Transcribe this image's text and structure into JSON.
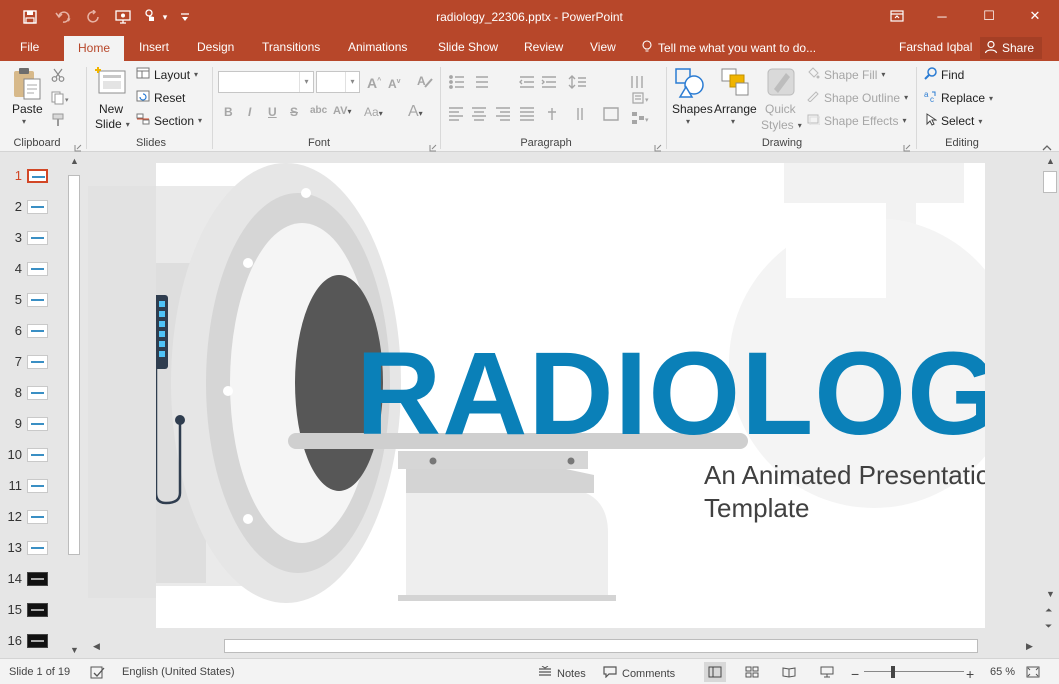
{
  "window": {
    "title": "radiology_22306.pptx - PowerPoint",
    "restore_icon": "ribbon-display-icon",
    "minimize": "─",
    "maximize": "☐",
    "close": "✕"
  },
  "quick_access": [
    "save-icon",
    "undo-icon",
    "redo-icon",
    "present-icon",
    "touch-mode-icon",
    "customize-icon"
  ],
  "tabs": {
    "file": "File",
    "home": "Home",
    "insert": "Insert",
    "design": "Design",
    "transitions": "Transitions",
    "animations": "Animations",
    "slideshow": "Slide Show",
    "review": "Review",
    "view": "View",
    "tellme": "Tell me what you want to do...",
    "user": "Farshad Iqbal",
    "share": "Share"
  },
  "ribbon": {
    "clipboard": {
      "label": "Clipboard",
      "paste": "Paste"
    },
    "slides": {
      "label": "Slides",
      "new_slide_1": "New",
      "new_slide_2": "Slide",
      "layout": "Layout",
      "reset": "Reset",
      "section": "Section"
    },
    "font": {
      "label": "Font",
      "bold": "B",
      "italic": "I",
      "underline": "U",
      "strike": "S",
      "spacing": "AV",
      "case": "Aa",
      "color": "A"
    },
    "paragraph": {
      "label": "Paragraph"
    },
    "drawing": {
      "label": "Drawing",
      "shapes": "Shapes",
      "arrange": "Arrange",
      "quick_styles_1": "Quick",
      "quick_styles_2": "Styles",
      "shape_fill": "Shape Fill",
      "shape_outline": "Shape Outline",
      "shape_effects": "Shape Effects"
    },
    "editing": {
      "label": "Editing",
      "find": "Find",
      "replace": "Replace",
      "select": "Select"
    }
  },
  "thumbnails": [
    {
      "num": "1",
      "dark": false,
      "selected": true
    },
    {
      "num": "2",
      "dark": false
    },
    {
      "num": "3",
      "dark": false
    },
    {
      "num": "4",
      "dark": false
    },
    {
      "num": "5",
      "dark": false
    },
    {
      "num": "6",
      "dark": false
    },
    {
      "num": "7",
      "dark": false
    },
    {
      "num": "8",
      "dark": false
    },
    {
      "num": "9",
      "dark": false
    },
    {
      "num": "10",
      "dark": false
    },
    {
      "num": "11",
      "dark": false
    },
    {
      "num": "12",
      "dark": false
    },
    {
      "num": "13",
      "dark": false
    },
    {
      "num": "14",
      "dark": true
    },
    {
      "num": "15",
      "dark": true
    },
    {
      "num": "16",
      "dark": true
    }
  ],
  "slide": {
    "title": "RADIOLOGY",
    "subtitle_line1": "An Animated Presentation",
    "subtitle_line2": "Template",
    "title_color": "#0a80b8"
  },
  "status": {
    "slide_info": "Slide 1 of 19",
    "language": "English (United States)",
    "notes": "Notes",
    "comments": "Comments",
    "zoom": "65 %",
    "zoom_minus": "−",
    "zoom_plus": "+"
  },
  "colors": {
    "accent": "#b7472a",
    "ribbon_bg": "#f3f3f3",
    "selection": "#d24726"
  }
}
